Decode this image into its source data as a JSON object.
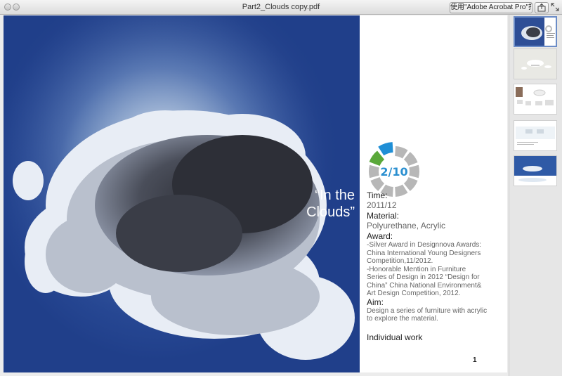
{
  "window": {
    "title": "Part2_Clouds copy.pdf",
    "open_button_label": "使用\"Adobe Acrobat Pro\"打开"
  },
  "page": {
    "headline_line1": "“In the",
    "headline_line2": "Clouds”",
    "progress": {
      "label": "2/10",
      "current": 2,
      "total": 10
    },
    "time_label": "Time:",
    "time_value": "2011/12",
    "material_label": "Material:",
    "material_value": "Polyurethane, Acrylic",
    "award_label": "Award:",
    "award_lines": [
      "-Silver Award in Designnova Awards:",
      "China International Young Designers",
      "Competition,11/2012.",
      "-Honorable Mention in Furniture",
      "Series of Design in 2012 “Design for",
      "China” China National Environment&",
      "Art Design Competition, 2012."
    ],
    "aim_label": "Aim:",
    "aim_lines": [
      "Design a series of furniture with acrylic",
      "to explore the material."
    ],
    "individual": "Individual work",
    "page_number": "1"
  },
  "colors": {
    "ring_gray": "#b7b7b7",
    "ring_green": "#5aa83a",
    "ring_blue": "#1f8fd6",
    "progress_text": "#2a8fd0"
  },
  "thumbnails": [
    {
      "name": "page-1",
      "selected": true
    },
    {
      "name": "page-2",
      "selected": false
    },
    {
      "name": "page-3",
      "selected": false
    },
    {
      "name": "page-4",
      "selected": false
    },
    {
      "name": "page-5",
      "selected": false
    }
  ]
}
